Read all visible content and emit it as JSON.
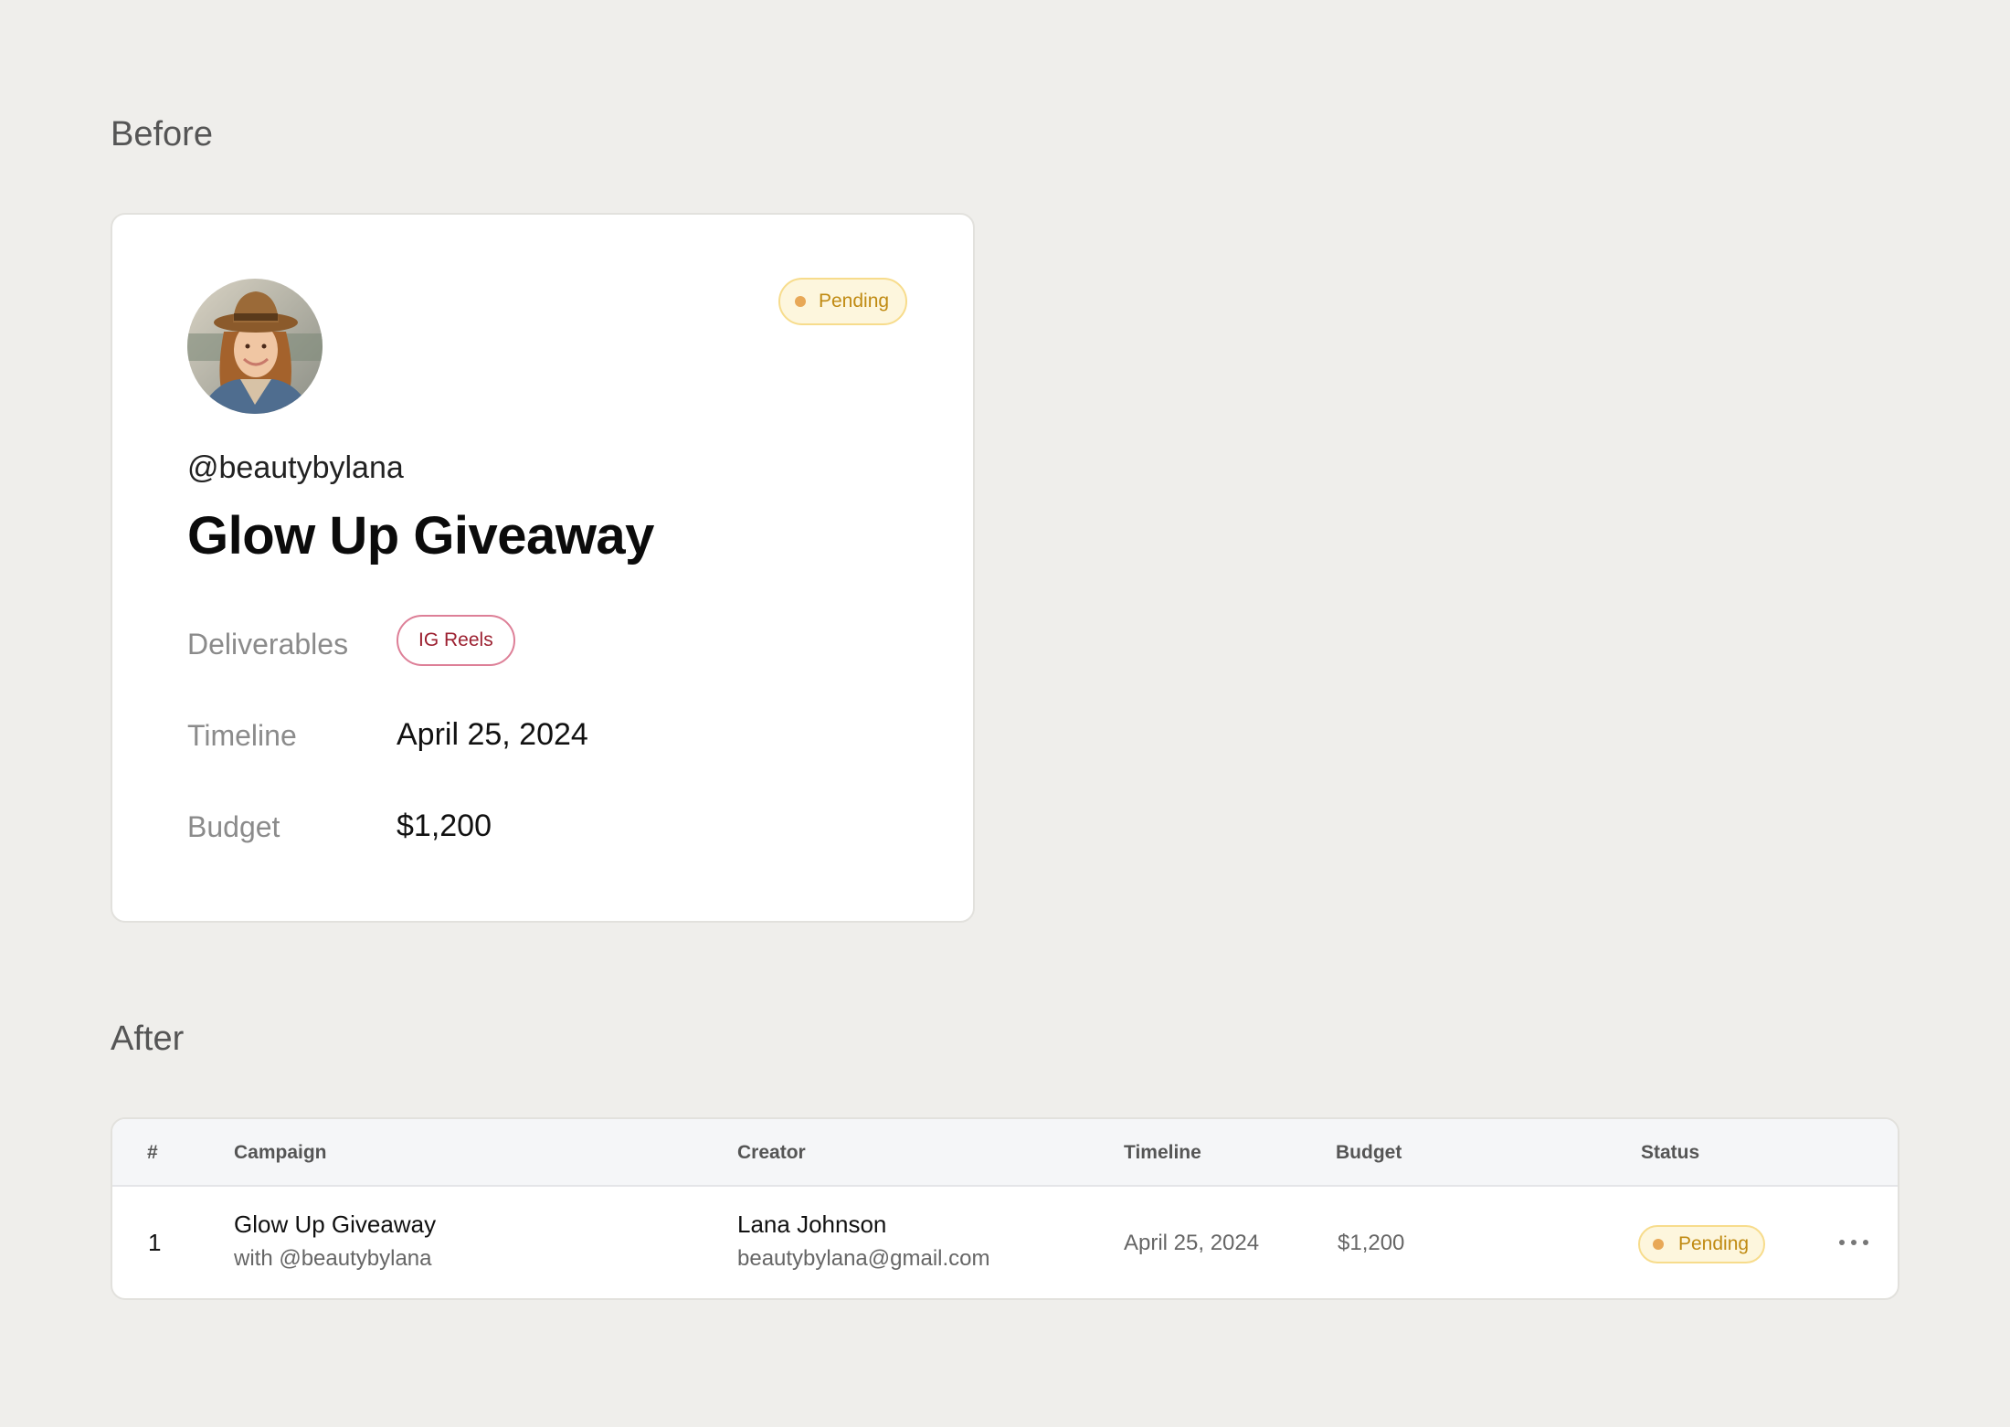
{
  "before": {
    "title": "Before",
    "card": {
      "status": "Pending",
      "handle": "@beautybylana",
      "campaign": "Glow Up Giveaway",
      "fields": {
        "deliverables_label": "Deliverables",
        "deliverable": "IG Reels",
        "timeline_label": "Timeline",
        "timeline": "April 25, 2024",
        "budget_label": "Budget",
        "budget": "$1,200"
      }
    }
  },
  "after": {
    "title": "After",
    "table": {
      "headers": {
        "num": "#",
        "campaign": "Campaign",
        "creator": "Creator",
        "timeline": "Timeline",
        "budget": "Budget",
        "status": "Status"
      },
      "rows": [
        {
          "num": "1",
          "campaign": "Glow Up Giveaway",
          "campaign_sub": "with @beautybylana",
          "creator": "Lana Johnson",
          "creator_email": "beautybylana@gmail.com",
          "timeline": "April 25, 2024",
          "budget": "$1,200",
          "status": "Pending"
        }
      ]
    }
  },
  "colors": {
    "background": "#efeeeb",
    "pending_text": "#c08a12",
    "pending_bg": "#fdf6dd",
    "pending_border": "#f7dc8c",
    "deliverable_border": "#dd7f97",
    "deliverable_text": "#9c2030"
  },
  "icons": {
    "status_dot": "status-dot-icon",
    "more": "more-horizontal-icon"
  }
}
